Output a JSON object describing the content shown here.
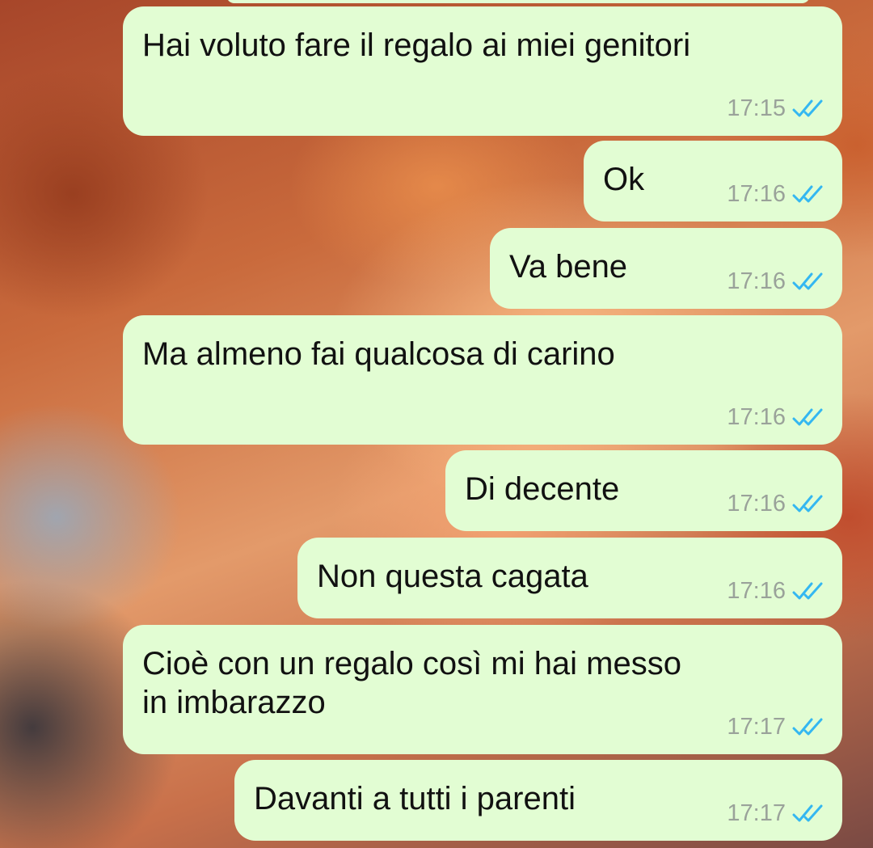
{
  "accent_colors": {
    "bubble_background": "#e2fdd3",
    "read_ticks": "#34b7f1",
    "timestamp": "#9aa29a"
  },
  "messages": [
    {
      "text": "Hai voluto fare il regalo ai miei genitori",
      "time": "17:15",
      "status_icon": "double-check-read-icon"
    },
    {
      "text": "Ok",
      "time": "17:16",
      "status_icon": "double-check-read-icon"
    },
    {
      "text": "Va bene",
      "time": "17:16",
      "status_icon": "double-check-read-icon"
    },
    {
      "text": "Ma almeno fai qualcosa di carino",
      "time": "17:16",
      "status_icon": "double-check-read-icon"
    },
    {
      "text": "Di decente",
      "time": "17:16",
      "status_icon": "double-check-read-icon"
    },
    {
      "text": "Non questa cagata",
      "time": "17:16",
      "status_icon": "double-check-read-icon"
    },
    {
      "text": "Cioè con un regalo così mi hai messo\nin imbarazzo",
      "time": "17:17",
      "status_icon": "double-check-read-icon"
    },
    {
      "text": "Davanti a tutti i parenti",
      "time": "17:17",
      "status_icon": "double-check-read-icon"
    }
  ]
}
